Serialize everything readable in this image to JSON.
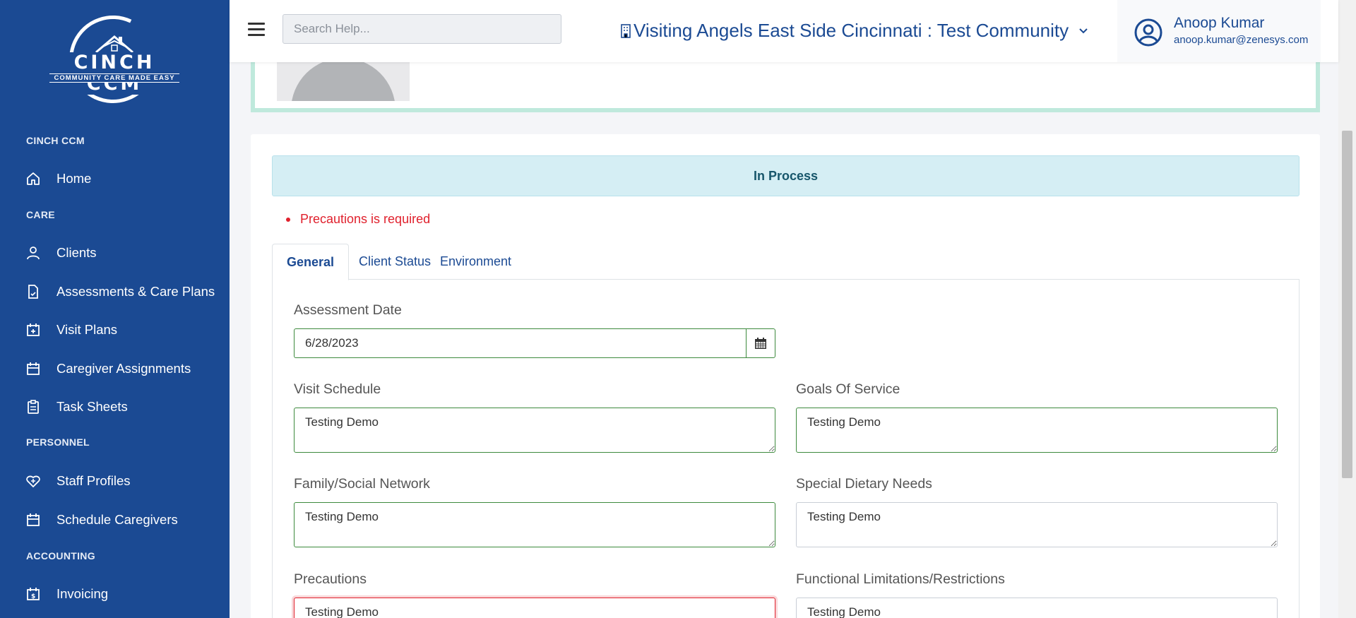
{
  "sidebar": {
    "logo": {
      "title": "CINCH CCM",
      "tagline": "COMMUNITY CARE MADE EASY"
    },
    "sections": {
      "cinch": "CINCH CCM",
      "care": "CARE",
      "personnel": "PERSONNEL",
      "accounting": "ACCOUNTING"
    },
    "items": {
      "home": {
        "label": "Home",
        "icon": "home-icon"
      },
      "clients": {
        "label": "Clients",
        "icon": "user-icon"
      },
      "assessments": {
        "label": "Assessments & Care Plans",
        "icon": "document-icon"
      },
      "visit_plans": {
        "label": "Visit Plans",
        "icon": "calendar-plus-icon"
      },
      "caregiver_assignments": {
        "label": "Caregiver Assignments",
        "icon": "calendar-icon"
      },
      "task_sheets": {
        "label": "Task Sheets",
        "icon": "clipboard-icon"
      },
      "staff_profiles": {
        "label": "Staff Profiles",
        "icon": "heart-badge-icon"
      },
      "schedule_caregivers": {
        "label": "Schedule Caregivers",
        "icon": "calendar-icon"
      },
      "invoicing": {
        "label": "Invoicing",
        "icon": "invoice-icon"
      }
    }
  },
  "header": {
    "search_placeholder": "Search Help...",
    "community": "Visiting Angels East Side Cincinnati : Test Community",
    "user": {
      "name": "Anoop Kumar",
      "email": "anoop.kumar@zenesys.com"
    }
  },
  "main": {
    "status": "In Process",
    "errors": [
      "Precautions is required"
    ],
    "tabs": [
      {
        "label": "General",
        "active": true
      },
      {
        "label": "Client Status",
        "active": false
      },
      {
        "label": "Environment",
        "active": false
      }
    ],
    "form": {
      "assessment_date": {
        "label": "Assessment Date",
        "value": "6/28/2023"
      },
      "visit_schedule": {
        "label": "Visit Schedule",
        "value": "Testing Demo"
      },
      "goals_of_service": {
        "label": "Goals Of Service",
        "value": "Testing Demo"
      },
      "family_social_network": {
        "label": "Family/Social Network",
        "value": "Testing Demo"
      },
      "special_dietary_needs": {
        "label": "Special Dietary Needs",
        "value": "Testing Demo"
      },
      "precautions": {
        "label": "Precautions",
        "value": "Testing Demo"
      },
      "functional_limitations": {
        "label": "Functional Limitations/Restrictions",
        "value": "Testing Demo"
      }
    }
  },
  "colors": {
    "sidebar_bg": "#1b4a93",
    "accent": "#1b4a93",
    "valid_border": "#3d8a3d",
    "error": "#e0212d",
    "status_bg": "#d5eef4"
  }
}
